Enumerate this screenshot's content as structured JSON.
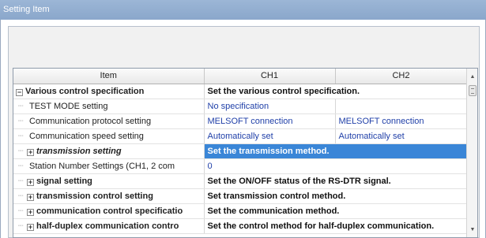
{
  "window": {
    "title": "Setting Item"
  },
  "table": {
    "headers": [
      "Item",
      "CH1",
      "CH2"
    ],
    "rows": [
      {
        "name": "Various control specification",
        "desc": "Set the various control specification."
      },
      {
        "name": "TEST MODE setting",
        "ch1": "No specification",
        "ch2": ""
      },
      {
        "name": "Communication protocol setting",
        "ch1": "MELSOFT connection",
        "ch2": "MELSOFT connection"
      },
      {
        "name": "Communication speed setting",
        "ch1": "Automatically set",
        "ch2": "Automatically set"
      },
      {
        "name": "transmission setting",
        "desc": "Set the transmission method."
      },
      {
        "name": "Station Number Settings (CH1, 2 com",
        "ch1": "0"
      },
      {
        "name": "signal setting",
        "desc": "Set the ON/OFF status of the RS-DTR signal."
      },
      {
        "name": "transmission control setting",
        "desc": "Set transmission control method."
      },
      {
        "name": "communication control specificatio",
        "desc": "Set the communication method."
      },
      {
        "name": "half-duplex communication contro",
        "desc": "Set the control method for half-duplex communication."
      }
    ]
  },
  "icons": {
    "collapse": "minus-box-icon",
    "expand": "plus-box-icon",
    "scroll_up": "scroll-up-arrow-icon",
    "scroll_down": "scroll-down-arrow-icon"
  },
  "colors": {
    "title_bar": "#8aa7cb",
    "selection": "#3a86d7",
    "value_text": "#1f3fa8"
  }
}
